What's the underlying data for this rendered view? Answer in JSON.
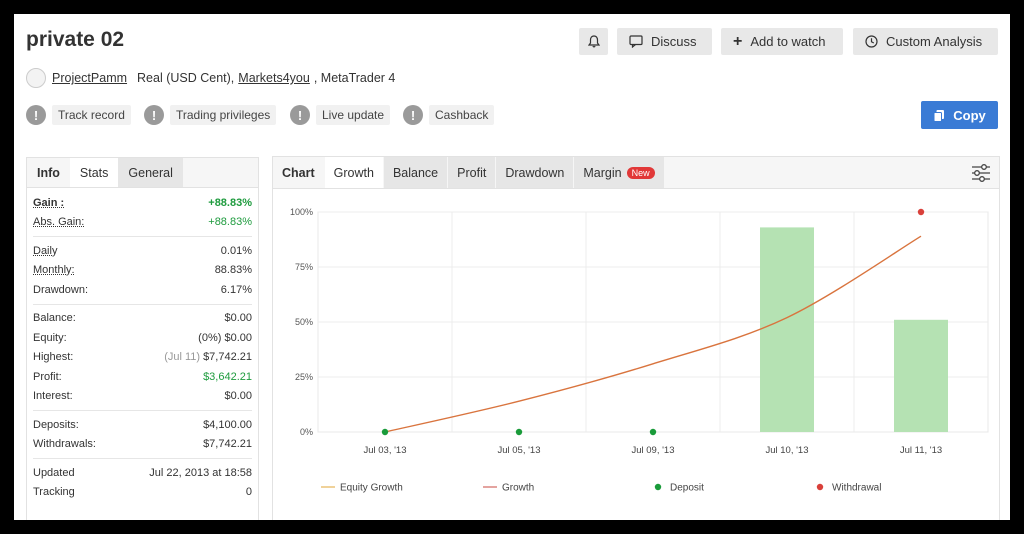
{
  "header": {
    "title": "private 02",
    "buttons": {
      "bell_icon": "bell-icon",
      "discuss": "Discuss",
      "add_watch": "Add to watch",
      "custom_analysis": "Custom Analysis"
    },
    "subline": {
      "author": "ProjectPamm",
      "account_type": "Real (USD Cent),",
      "broker": "Markets4you",
      "platform": ", MetaTrader 4"
    },
    "chips": [
      "Track record",
      "Trading privileges",
      "Live update",
      "Cashback"
    ],
    "copy_button": "Copy"
  },
  "stats_panel": {
    "tabs": [
      "Info",
      "Stats",
      "General"
    ],
    "rows": {
      "gain": {
        "label": "Gain :",
        "value": "+88.83%"
      },
      "abs_gain": {
        "label": "Abs. Gain:",
        "value": "+88.83%"
      },
      "daily": {
        "label": "Daily",
        "value": "0.01%"
      },
      "monthly": {
        "label": "Monthly:",
        "value": "88.83%"
      },
      "drawdown": {
        "label": "Drawdown:",
        "value": "6.17%"
      },
      "balance": {
        "label": "Balance:",
        "value": "$0.00"
      },
      "equity": {
        "label": "Equity:",
        "prefix": "(0%)",
        "value": "$0.00"
      },
      "highest": {
        "label": "Highest:",
        "prefix": "(Jul 11)",
        "value": "$7,742.21"
      },
      "profit": {
        "label": "Profit:",
        "value": "$3,642.21"
      },
      "interest": {
        "label": "Interest:",
        "value": "$0.00"
      },
      "deposits": {
        "label": "Deposits:",
        "value": "$4,100.00"
      },
      "withdrawals": {
        "label": "Withdrawals:",
        "value": "$7,742.21"
      },
      "updated": {
        "label": "Updated",
        "value": "Jul 22, 2013 at 18:58"
      },
      "tracking": {
        "label": "Tracking",
        "value": "0"
      }
    }
  },
  "chart_panel": {
    "tabs": [
      "Chart",
      "Growth",
      "Balance",
      "Profit",
      "Drawdown",
      "Margin"
    ],
    "new_badge": "New",
    "settings_icon": "sliders-icon"
  },
  "colors": {
    "accent": "#3a7bd5",
    "green_text": "#1e9b3e",
    "growth_line": "#d9743e",
    "bar": "#b5e2b3",
    "deposit": "#1a9b3a",
    "withdrawal": "#d9403a"
  },
  "chart_data": {
    "type": "line",
    "categories": [
      "Jul 03, '13",
      "Jul 05, '13",
      "Jul 09, '13",
      "Jul 10, '13",
      "Jul 11, '13"
    ],
    "yticks": [
      "0%",
      "25%",
      "50%",
      "75%",
      "100%"
    ],
    "ylim": [
      0,
      100
    ],
    "series": [
      {
        "name": "Equity Growth",
        "values": [
          0,
          0,
          0,
          0,
          0
        ]
      },
      {
        "name": "Growth",
        "values": [
          0,
          14,
          31,
          52,
          89
        ]
      },
      {
        "name": "Deposit",
        "values": [
          0,
          0,
          0,
          null,
          null
        ]
      },
      {
        "name": "Withdrawal",
        "values": [
          null,
          null,
          null,
          null,
          100
        ]
      }
    ],
    "bars": [
      null,
      null,
      null,
      93,
      51
    ],
    "legend": [
      "Equity Growth",
      "Growth",
      "Deposit",
      "Withdrawal"
    ],
    "legend_position": "bottom",
    "grid": true
  }
}
